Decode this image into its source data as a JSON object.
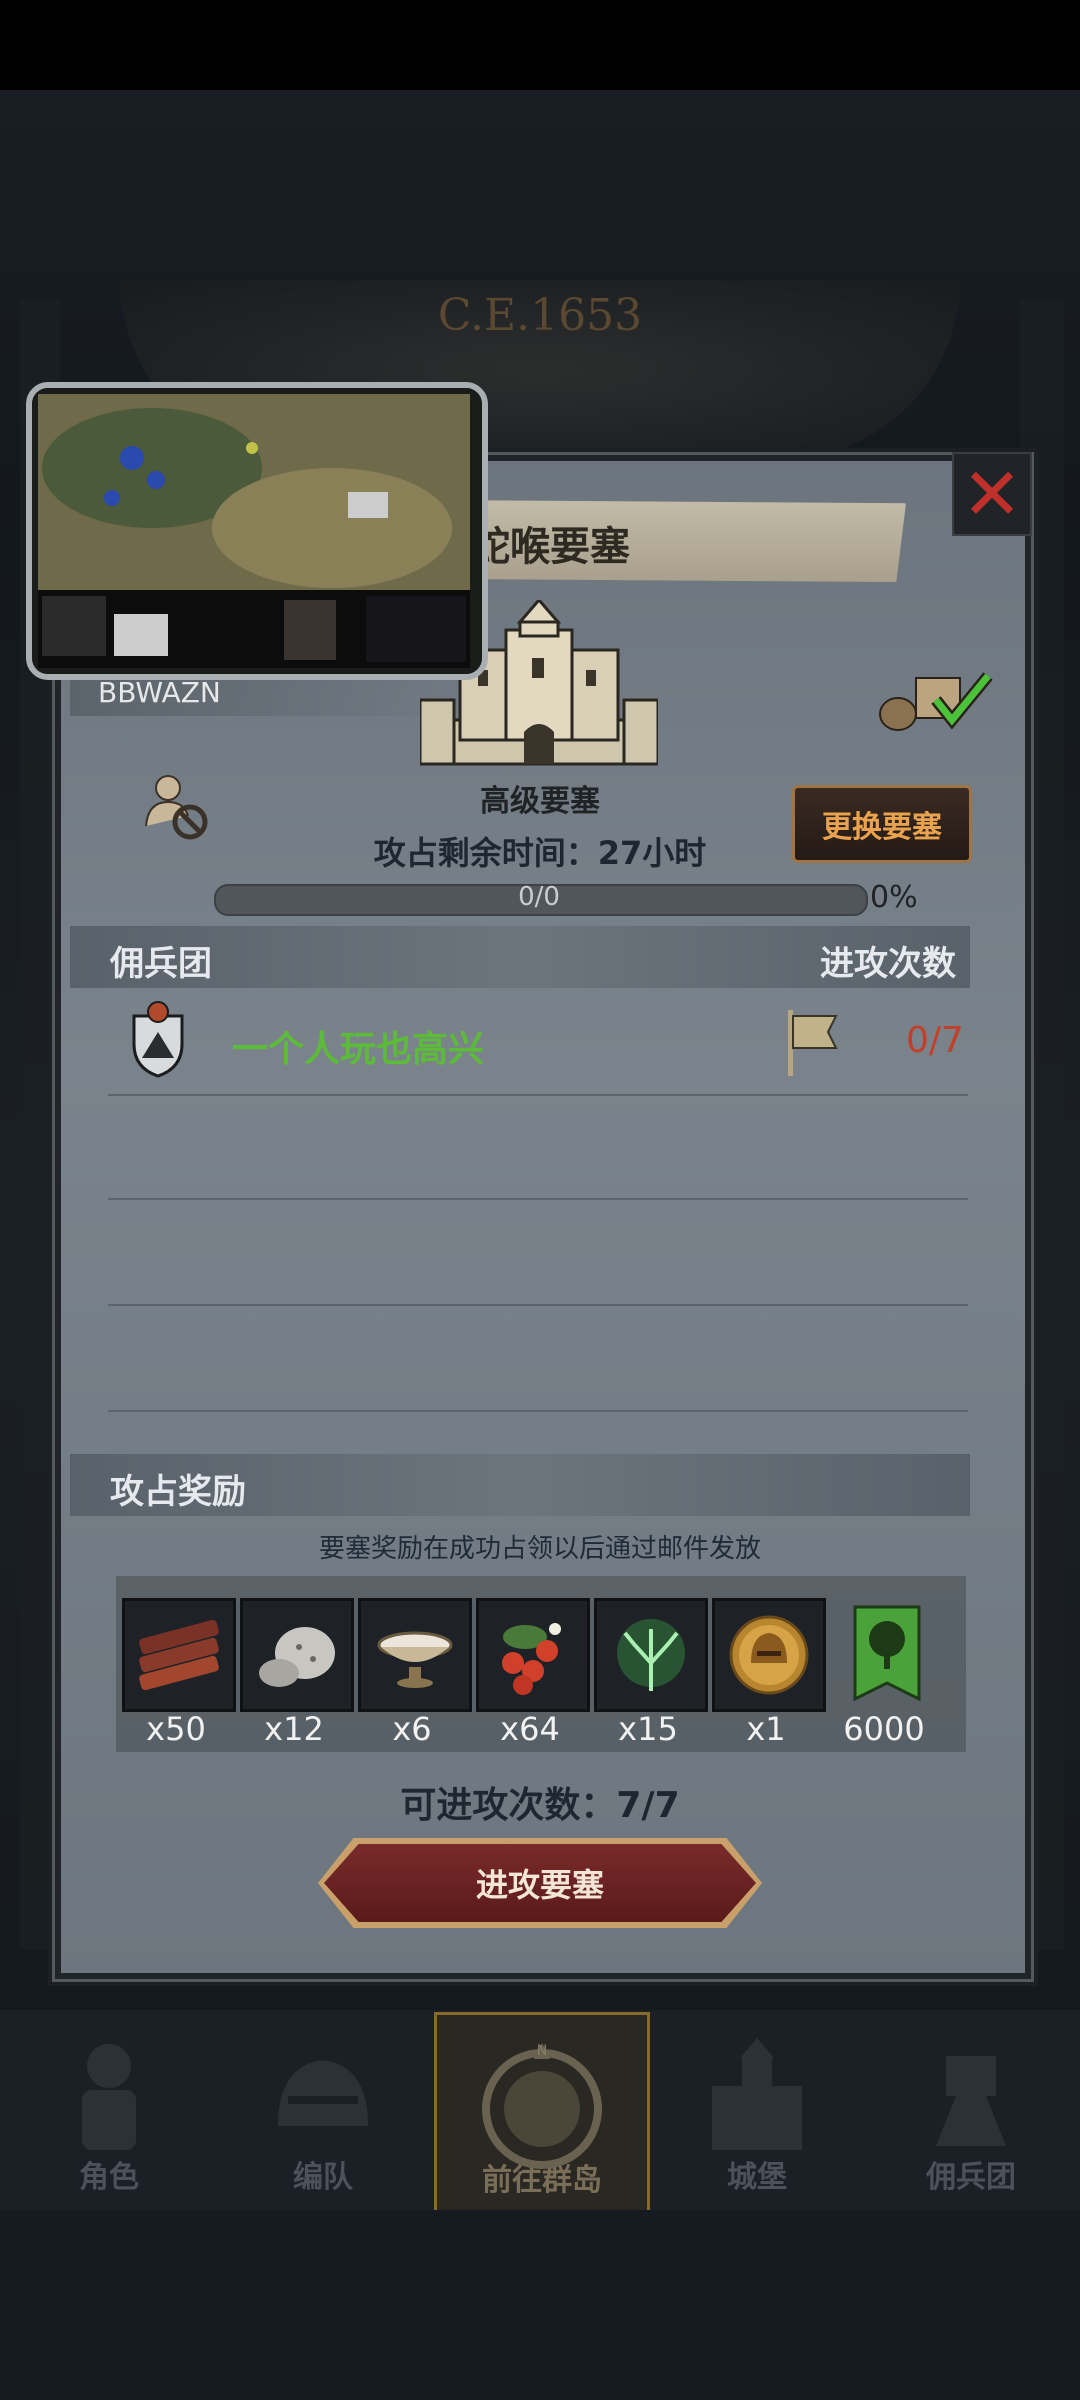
{
  "header": {
    "year": "C.E.1653"
  },
  "fortress": {
    "title": "蛇喉要塞",
    "owner": "BBWAZN",
    "level": "高级要塞",
    "remaining_time": "攻占剩余时间：27小时",
    "change_button": "更换要塞",
    "progress_text": "0/0",
    "progress_percent": "0%",
    "progress_value": 0
  },
  "mercenary": {
    "section_label": "佣兵团",
    "attack_count_label": "进攻次数",
    "rows": [
      {
        "name": "一个人玩也高兴",
        "count": "0/7"
      }
    ]
  },
  "rewards": {
    "section_label": "攻占奖励",
    "note": "要塞奖励在成功占领以后通过邮件发放",
    "items": [
      {
        "icon": "wood-logs-icon",
        "qty": "x50"
      },
      {
        "icon": "stone-ore-icon",
        "qty": "x12"
      },
      {
        "icon": "white-bowl-icon",
        "qty": "x6"
      },
      {
        "icon": "berries-icon",
        "qty": "x64"
      },
      {
        "icon": "green-spirit-tree-icon",
        "qty": "x15"
      },
      {
        "icon": "golden-helmet-medal-icon",
        "qty": "x1"
      },
      {
        "icon": "tree-banner-icon",
        "qty": "6000"
      }
    ]
  },
  "attempts": "可进攻次数：7/7",
  "attack_button": "进攻要塞",
  "nav": {
    "items": [
      {
        "label": "角色"
      },
      {
        "label": "编队"
      },
      {
        "label": "前往群岛"
      },
      {
        "label": "城堡"
      },
      {
        "label": "佣兵团"
      }
    ]
  }
}
